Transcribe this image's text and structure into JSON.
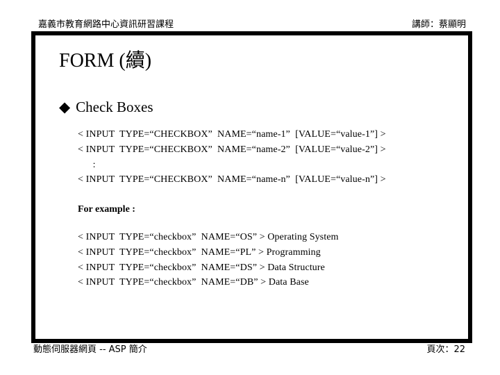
{
  "header": {
    "course": "嘉義市教育網路中心資訊研習課程",
    "instructor": "講師：蔡顯明"
  },
  "slide": {
    "title": "FORM (續)",
    "bullet": {
      "icon": "diamond-icon",
      "glyph": "◆",
      "text": "Check Boxes"
    },
    "syntax_lines": [
      "< INPUT  TYPE=“CHECKBOX”  NAME=“name-1”  [VALUE=“value-1”] >",
      "< INPUT  TYPE=“CHECKBOX”  NAME=“name-2”  [VALUE=“value-2”] >",
      "      :",
      "< INPUT  TYPE=“CHECKBOX”  NAME=“name-n”  [VALUE=“value-n”] >"
    ],
    "example_label": "For example :",
    "example_lines": [
      "< INPUT  TYPE=“checkbox”  NAME=“OS” > Operating System",
      "< INPUT  TYPE=“checkbox”  NAME=“PL” > Programming",
      "< INPUT  TYPE=“checkbox”  NAME=“DS” > Data Structure",
      "< INPUT  TYPE=“checkbox”  NAME=“DB” > Data Base"
    ]
  },
  "footer": {
    "topic": "動態伺服器網頁 -- ASP 簡介",
    "page": "頁次：22"
  }
}
